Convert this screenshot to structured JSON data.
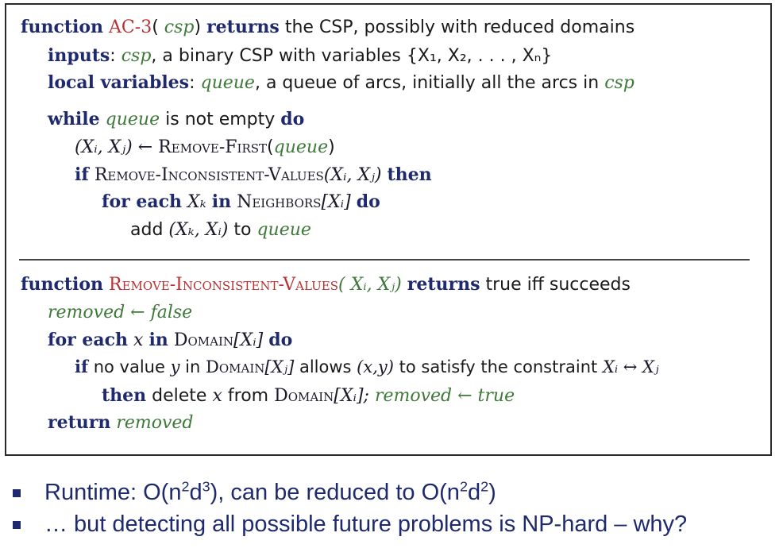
{
  "ac3": {
    "l1_kw1": "function",
    "l1_name": "AC-3",
    "l1_open": "(",
    "l1_param": "csp",
    "l1_close": ")",
    "l1_kw2": "returns",
    "l1_rest": "the CSP, possibly with reduced domains",
    "l2_kw": "inputs",
    "l2_colon": ":",
    "l2_var": "csp",
    "l2_text": ", a binary CSP with variables {X₁, X₂, . . . , Xₙ}",
    "l3_kw": "local variables",
    "l3_colon": ":",
    "l3_var": "queue",
    "l3_text": ", a queue of arcs, initially all the arcs in",
    "l3_var2": "csp",
    "l4_kw1": "while",
    "l4_var": "queue",
    "l4_text": "is not empty",
    "l4_kw2": "do",
    "l5_math": "(Xᵢ, Xⱼ) ←",
    "l5_fn": "Remove-First",
    "l5_open": "(",
    "l5_var": "queue",
    "l5_close": ")",
    "l6_kw1": "if",
    "l6_fn": "Remove-Inconsistent-Values",
    "l6_args": "(Xᵢ, Xⱼ)",
    "l6_kw2": "then",
    "l7_kw1": "for each",
    "l7_math": "Xₖ",
    "l7_kw2": "in",
    "l7_fn": "Neighbors",
    "l7_args": "[Xᵢ]",
    "l7_kw3": "do",
    "l8_text1": "add",
    "l8_math": "(Xₖ, Xᵢ)",
    "l8_text2": "to",
    "l8_var": "queue"
  },
  "riv": {
    "l1_kw1": "function",
    "l1_name": "Remove-Inconsistent-Values",
    "l1_args": "( Xᵢ, Xⱼ)",
    "l1_kw2": "returns",
    "l1_rest": "true iff succeeds",
    "l2_var": "removed ← false",
    "l3_kw1": "for each",
    "l3_math": "x",
    "l3_kw2": "in",
    "l3_fn": "Domain",
    "l3_args": "[Xᵢ]",
    "l3_kw3": "do",
    "l4_kw": "if",
    "l4_text1": "no value",
    "l4_math1": "y",
    "l4_text2": "in",
    "l4_fn": "Domain",
    "l4_args": "[Xⱼ]",
    "l4_text3": "allows",
    "l4_math2": "(x,y)",
    "l4_text4": "to satisfy the constraint",
    "l4_math3": "Xᵢ  ↔  Xⱼ",
    "l5_kw": "then",
    "l5_text1": "delete",
    "l5_math": "x",
    "l5_text2": "from",
    "l5_fn": "Domain",
    "l5_args": "[Xᵢ];",
    "l5_var": "removed ← true",
    "l6_kw": "return",
    "l6_var": "removed"
  },
  "bullets": {
    "b1_a": "Runtime: O(n",
    "b1_sup1": "2",
    "b1_b": "d",
    "b1_sup2": "3",
    "b1_c": "), can be reduced to O(n",
    "b1_sup3": "2",
    "b1_d": "d",
    "b1_sup4": "2",
    "b1_e": ")",
    "b2": "… but detecting all possible future problems is NP-hard – why?"
  }
}
